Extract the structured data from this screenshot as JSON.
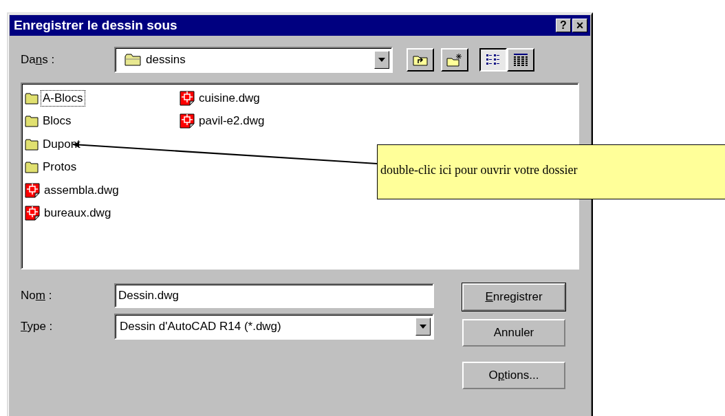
{
  "window": {
    "title": "Enregistrer le dessin sous",
    "buttons": [
      {
        "kind": "help",
        "label": "?"
      },
      {
        "kind": "close",
        "label": "×"
      }
    ]
  },
  "location": {
    "label": [
      {
        "text": "Da",
        "underlined": false
      },
      {
        "text": "n",
        "underlined": true
      },
      {
        "text": "s :",
        "underlined": false
      }
    ],
    "value": "dessins"
  },
  "toolbar": [
    {
      "kind": "up",
      "selected": false
    },
    {
      "kind": "newfolder",
      "selected": false
    },
    {
      "kind": "list",
      "selected": true
    },
    {
      "kind": "details",
      "selected": false
    }
  ],
  "files": [
    {
      "name": "A-Blocs",
      "kind": "folder",
      "selected": true
    },
    {
      "name": "Blocs",
      "kind": "folder",
      "selected": false
    },
    {
      "name": "Dupont",
      "kind": "folder",
      "selected": false
    },
    {
      "name": "Protos",
      "kind": "folder",
      "selected": false
    },
    {
      "name": "assembla.dwg",
      "kind": "dwg",
      "selected": false
    },
    {
      "name": "bureaux.dwg",
      "kind": "dwg",
      "selected": false
    },
    {
      "name": "cuisine.dwg",
      "kind": "dwg",
      "selected": false
    },
    {
      "name": "pavil-e2.dwg",
      "kind": "dwg",
      "selected": false
    }
  ],
  "name_field": {
    "label": [
      {
        "text": "No",
        "underlined": false
      },
      {
        "text": "m",
        "underlined": true
      },
      {
        "text": " :",
        "underlined": false
      }
    ],
    "value": "Dessin.dwg"
  },
  "type_field": {
    "label": [
      {
        "text": "T",
        "underlined": true
      },
      {
        "text": "ype :",
        "underlined": false
      }
    ],
    "value": "Dessin d'AutoCAD R14 (*.dwg)"
  },
  "buttons": [
    {
      "label": [
        {
          "text": "E",
          "underlined": true
        },
        {
          "text": "nregistrer",
          "underlined": false
        }
      ],
      "default": true
    },
    {
      "label": [
        {
          "text": "Annuler",
          "underlined": false
        }
      ],
      "default": false
    },
    {
      "label": [
        {
          "text": "O",
          "underlined": false
        },
        {
          "text": "p",
          "underlined": true
        },
        {
          "text": "tions...",
          "underlined": false
        }
      ],
      "default": false
    }
  ],
  "annotation": {
    "text": "double-clic ici pour ouvrir votre dossier"
  }
}
